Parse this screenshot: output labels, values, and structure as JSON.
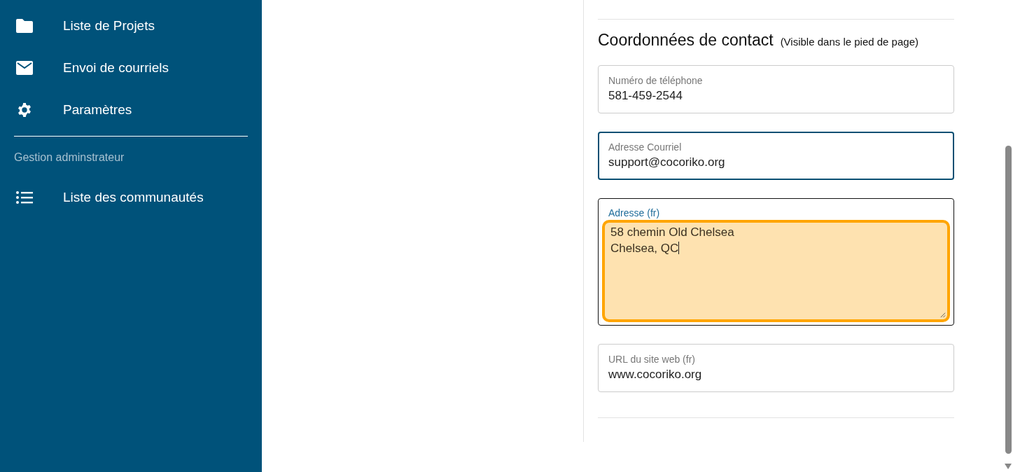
{
  "sidebar": {
    "items": [
      {
        "kind": "folder",
        "label": "Liste de Projets"
      },
      {
        "kind": "mail",
        "label": "Envoi de courriels"
      },
      {
        "kind": "gear",
        "label": "Paramètres"
      }
    ],
    "section_title": "Gestion adminstrateur",
    "admin_items": [
      {
        "kind": "list",
        "label": "Liste des communautés"
      }
    ]
  },
  "contact": {
    "title": "Coordonnées de contact",
    "subtitle": "(Visible dans le pied de page)",
    "fields": [
      {
        "kind": "input",
        "label": "Numéro de téléphone",
        "value": "581-459-2544",
        "focused": false
      },
      {
        "kind": "input",
        "label": "Adresse Courriel",
        "value": "support@cocoriko.org",
        "focused": true
      },
      {
        "kind": "textarea",
        "label": "Adresse (fr)",
        "value": "58 chemin Old Chelsea\nChelsea, QC",
        "focused": false,
        "highlighted": true
      },
      {
        "kind": "input",
        "label": "URL du site web (fr)",
        "value": "www.cocoriko.org",
        "focused": false
      }
    ]
  }
}
